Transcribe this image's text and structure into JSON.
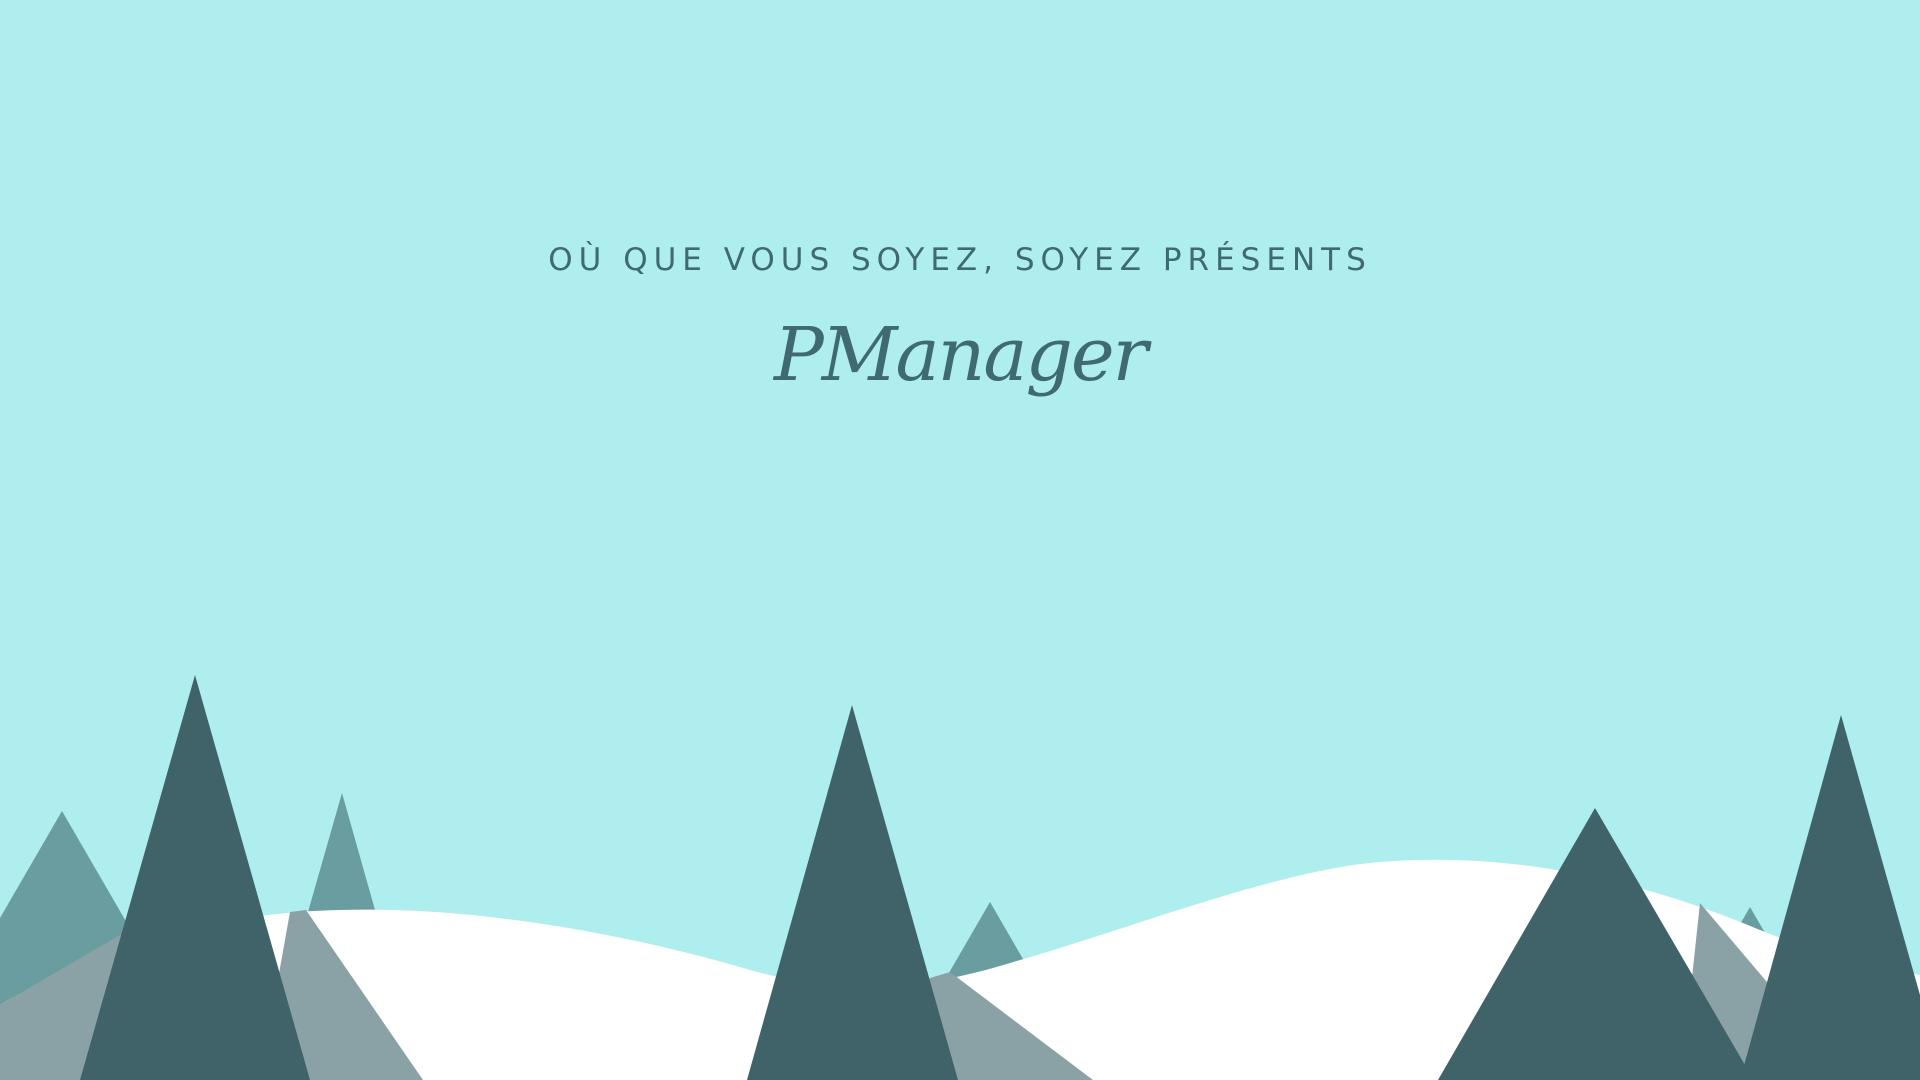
{
  "hero": {
    "tagline": "OÙ QUE VOUS SOYEZ, SOYEZ PRÉSENTS",
    "brand": "PManager"
  },
  "colors": {
    "sky": "#AEEEEE",
    "snow": "#FFFFFF",
    "tree_dark": "#3F6369",
    "tree_light_on_sky": "#6A9DA0",
    "tree_light_on_snow": "#8AA2A6",
    "text": "#3F6A72"
  }
}
